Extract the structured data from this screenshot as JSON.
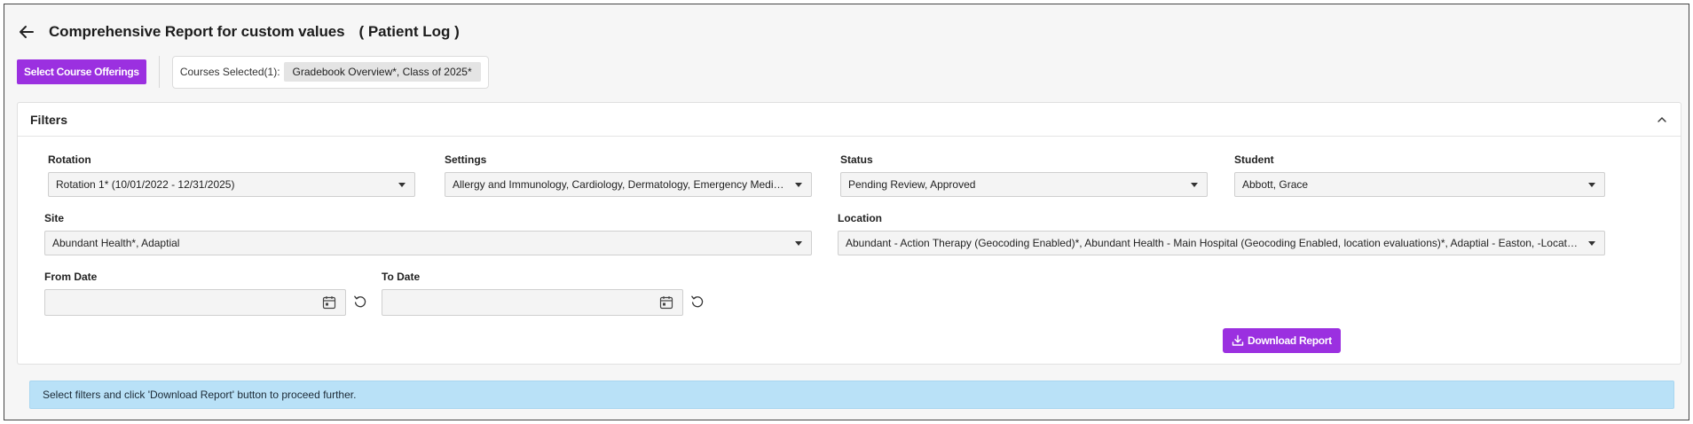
{
  "header": {
    "title": "Comprehensive Report for custom values",
    "subtitle": "( Patient Log )"
  },
  "toolbar": {
    "select_courses_label": "Select Course Offerings",
    "courses_selected_label": "Courses Selected(1):",
    "courses_selected_chip": "Gradebook Overview*, Class of 2025*"
  },
  "filters": {
    "title": "Filters",
    "rotation": {
      "label": "Rotation",
      "value": "Rotation 1* (10/01/2022 - 12/31/2025)"
    },
    "settings": {
      "label": "Settings",
      "value": "Allergy and Immunology, Cardiology, Dermatology, Emergency Medicine, Family Medicine"
    },
    "status": {
      "label": "Status",
      "value": "Pending Review, Approved"
    },
    "student": {
      "label": "Student",
      "value": "Abbott, Grace"
    },
    "site": {
      "label": "Site",
      "value": "Abundant Health*, Adaptial"
    },
    "location": {
      "label": "Location",
      "value": "Abundant - Action Therapy (Geocoding Enabled)*, Abundant Health - Main Hospital (Geocoding Enabled, location evaluations)*, Adaptial - Easton, -Location evaluations"
    },
    "from_date": {
      "label": "From Date",
      "value": "",
      "placeholder": ""
    },
    "to_date": {
      "label": "To Date",
      "value": "",
      "placeholder": ""
    },
    "download_label": "Download Report"
  },
  "info": {
    "message": "Select filters and click 'Download Report' button to proceed further."
  },
  "colors": {
    "accent": "#9b30e0",
    "info_bg": "#b9e1f7"
  },
  "icons": {
    "back": "arrow-left-icon",
    "collapse": "chevron-up-icon",
    "calendar": "calendar-icon",
    "reset": "reset-icon",
    "download": "download-icon"
  }
}
